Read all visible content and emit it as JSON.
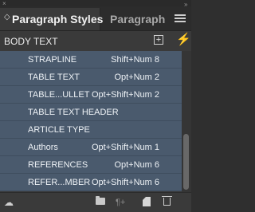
{
  "tabs": [
    {
      "label": "Paragraph Styles",
      "active": true
    },
    {
      "label": "Paragraph",
      "active": false
    }
  ],
  "panel_controls": {
    "close_glyph": "×",
    "collapse_glyph": "»",
    "chevron_glyph": "◇"
  },
  "group": {
    "label": "BODY TEXT",
    "new_style_glyph": "+",
    "quick_apply_glyph": "⚡"
  },
  "styles": [
    {
      "name": "STRAPLINE",
      "shortcut": "Shift+Num 8"
    },
    {
      "name": "TABLE TEXT",
      "shortcut": "Opt+Num 2"
    },
    {
      "name": "TABLE...ULLET",
      "shortcut": "Opt+Shift+Num 2"
    },
    {
      "name": "TABLE TEXT HEADER",
      "shortcut": ""
    },
    {
      "name": "ARTICLE TYPE",
      "shortcut": ""
    },
    {
      "name": "Authors",
      "shortcut": "Opt+Shift+Num 1"
    },
    {
      "name": "REFERENCES",
      "shortcut": "Opt+Num 6"
    },
    {
      "name": "REFER...MBER",
      "shortcut": "Opt+Shift+Num 6"
    }
  ],
  "bottom_bar": {
    "cloud_glyph": "☁",
    "clear_override_glyph": "¶+",
    "style_override_glyph": "⁂"
  },
  "colors": {
    "panel_bg": "#3a3a3a",
    "row_selected": "#4a5a6d",
    "text": "#e6e6e6"
  }
}
